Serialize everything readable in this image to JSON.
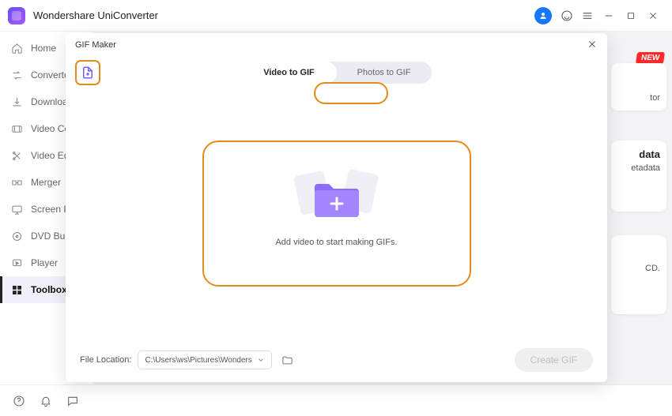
{
  "titlebar": {
    "title": "Wondershare UniConverter"
  },
  "sidebar": {
    "items": [
      {
        "label": "Home"
      },
      {
        "label": "Converter"
      },
      {
        "label": "Downloader"
      },
      {
        "label": "Video Compressor"
      },
      {
        "label": "Video Editor"
      },
      {
        "label": "Merger"
      },
      {
        "label": "Screen Recorder"
      },
      {
        "label": "DVD Burner"
      },
      {
        "label": "Player"
      },
      {
        "label": "Toolbox"
      }
    ]
  },
  "peek": {
    "new_badge": "NEW",
    "card1_suffix": "tor",
    "card2_title": "data",
    "card2_sub": "etadata",
    "card3_text": "CD."
  },
  "modal": {
    "title": "GIF Maker",
    "tabs": {
      "video": "Video to GIF",
      "photos": "Photos to GIF"
    },
    "drop_msg": "Add video to start making GIFs.",
    "file_label": "File Location:",
    "path_value": "C:\\Users\\ws\\Pictures\\Wonders",
    "create_label": "Create GIF"
  }
}
